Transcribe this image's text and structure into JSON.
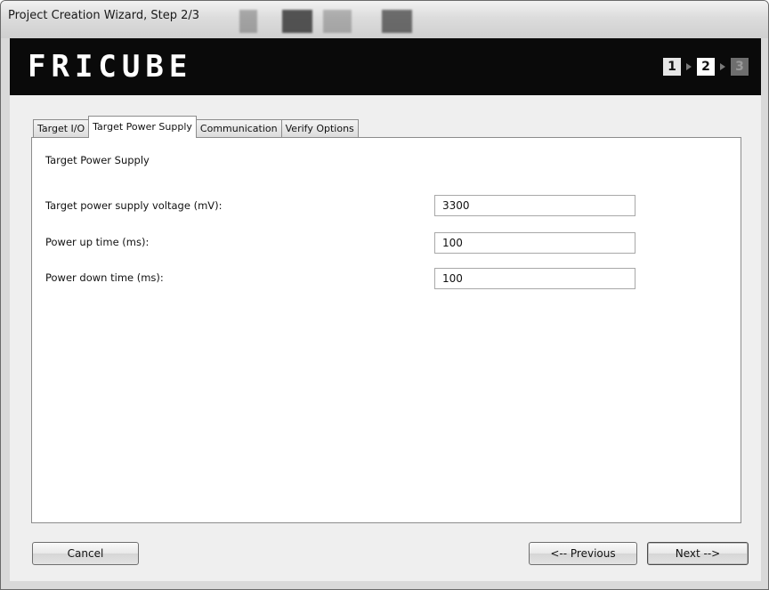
{
  "window": {
    "title": "Project Creation Wizard, Step 2/3"
  },
  "banner": {
    "logo_text": "FRICUBE",
    "steps": [
      {
        "label": "1",
        "state": "done"
      },
      {
        "label": "2",
        "state": "current"
      },
      {
        "label": "3",
        "state": "future"
      }
    ]
  },
  "tabs": [
    {
      "label": "Target I/O",
      "active": false
    },
    {
      "label": "Target Power Supply",
      "active": true
    },
    {
      "label": "Communication",
      "active": false
    },
    {
      "label": "Verify Options",
      "active": false
    }
  ],
  "panel": {
    "heading": "Target Power Supply",
    "fields": [
      {
        "label": "Target power supply voltage (mV):",
        "value": "3300"
      },
      {
        "label": "Power up time (ms):",
        "value": "100"
      },
      {
        "label": "Power down time (ms):",
        "value": "100"
      }
    ]
  },
  "buttons": {
    "cancel": "Cancel",
    "previous": "<-- Previous",
    "next": "Next -->"
  },
  "colors": {
    "banner_bg": "#0a0a0a",
    "window_bg": "#d9d9d9",
    "panel_bg": "#ffffff"
  }
}
